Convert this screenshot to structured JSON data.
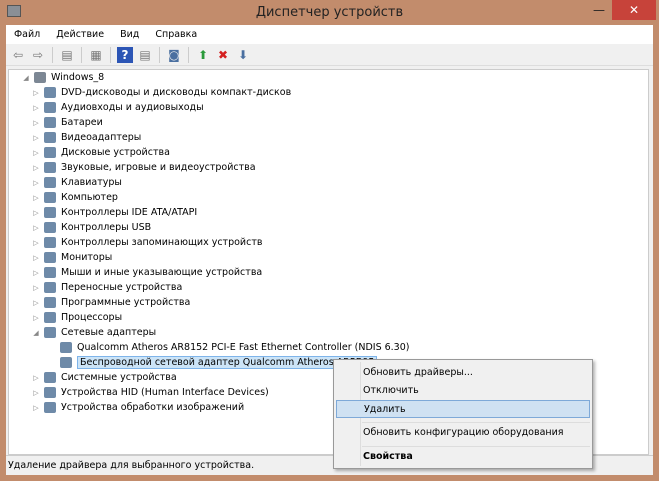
{
  "window": {
    "title": "Диспетчер устройств",
    "minimize": "—",
    "close": "✕"
  },
  "menu": [
    "Файл",
    "Действие",
    "Вид",
    "Справка"
  ],
  "toolbar": [
    "back-icon",
    "forward-icon",
    "show-hide-tree-icon",
    "properties-icon",
    "help-icon",
    "action-pane-icon",
    "scan-hardware-icon",
    "update-driver-icon",
    "uninstall-icon",
    "disable-icon"
  ],
  "tree": {
    "root": "Windows_8",
    "items": [
      "DVD-дисководы и дисководы компакт-дисков",
      "Аудиовходы и аудиовыходы",
      "Батареи",
      "Видеоадаптеры",
      "Дисковые устройства",
      "Звуковые, игровые и видеоустройства",
      "Клавиатуры",
      "Компьютер",
      "Контроллеры IDE ATA/ATAPI",
      "Контроллеры USB",
      "Контроллеры запоминающих устройств",
      "Мониторы",
      "Мыши и иные указывающие устройства",
      "Переносные устройства",
      "Программные устройства",
      "Процессоры",
      "Сетевые адаптеры"
    ],
    "children": [
      "Qualcomm Atheros AR8152 PCI-E Fast Ethernet Controller (NDIS 6.30)",
      "Беспроводной сетевой адаптер Qualcomm Atheros AR5B95"
    ],
    "after": [
      "Системные устройства",
      "Устройства HID (Human Interface Devices)",
      "Устройства обработки изображений"
    ]
  },
  "context_menu": {
    "update": "Обновить драйверы...",
    "disable": "Отключить",
    "uninstall": "Удалить",
    "scan": "Обновить конфигурацию оборудования",
    "properties": "Свойства"
  },
  "status": "Удаление драйвера для выбранного устройства."
}
